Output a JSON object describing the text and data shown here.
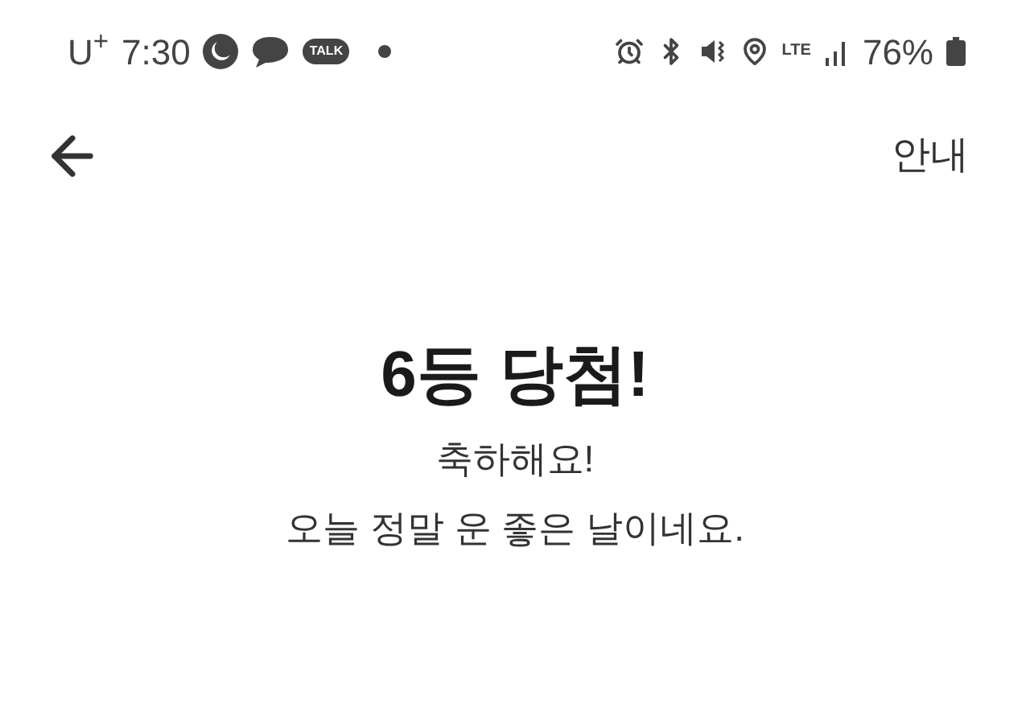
{
  "status_bar": {
    "carrier": "U$^{+}$",
    "time": "7:30",
    "chat_badge": "TALK",
    "network": "LTE",
    "battery": "76%"
  },
  "header": {
    "help_link": "안내"
  },
  "result": {
    "title": "6등 당첨!",
    "lines": [
      "축하해요!",
      "오늘 정말 운 좋은 날이네요."
    ]
  }
}
